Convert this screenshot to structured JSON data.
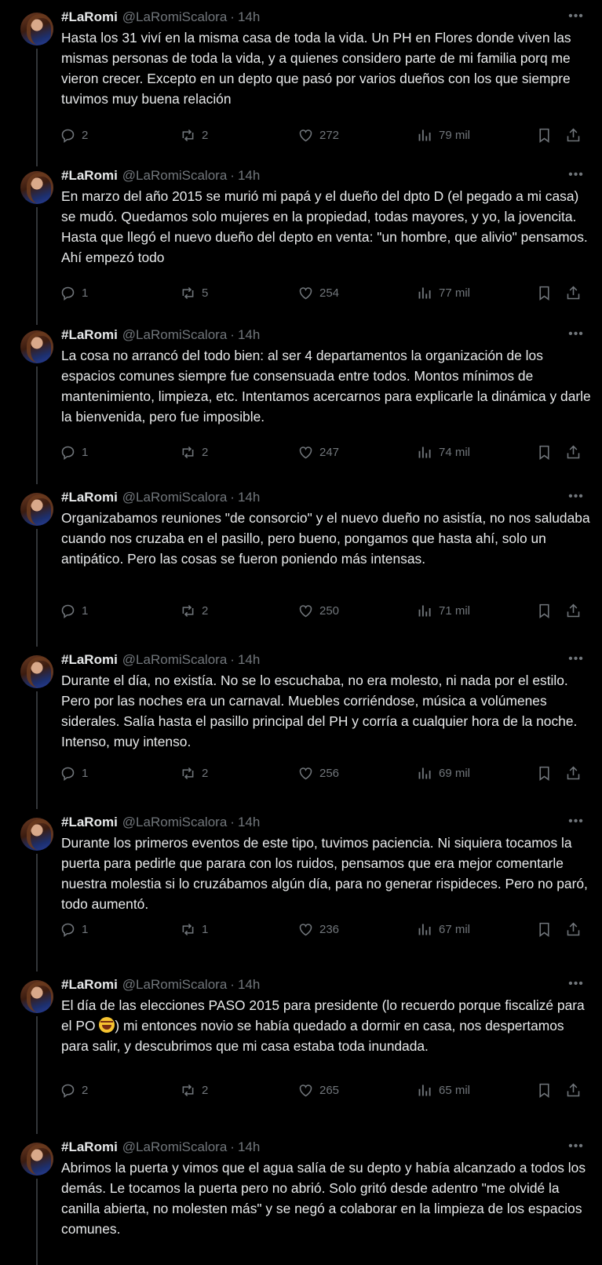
{
  "tweets": [
    {
      "name": "#LaRomi",
      "handle": "@LaRomiScalora",
      "time": "14h",
      "text": "Hasta los 31 viví en la misma casa de toda la vida. Un PH en Flores donde viven las mismas personas de toda la vida, y a quienes considero parte de mi familia porq me vieron crecer. Excepto en un depto que pasó por varios dueños con los que siempre tuvimos muy buena relación",
      "replies": "2",
      "retweets": "2",
      "likes": "272",
      "views": "79 mil"
    },
    {
      "name": "#LaRomi",
      "handle": "@LaRomiScalora",
      "time": "14h",
      "text": "En marzo del año 2015 se murió mi papá y el dueño del dpto D (el pegado a mi casa) se mudó. Quedamos solo mujeres en la propiedad, todas mayores, y yo, la jovencita. Hasta que llegó el nuevo dueño del depto en venta: \"un hombre, que alivio\" pensamos. Ahí empezó todo",
      "replies": "1",
      "retweets": "5",
      "likes": "254",
      "views": "77 mil"
    },
    {
      "name": "#LaRomi",
      "handle": "@LaRomiScalora",
      "time": "14h",
      "text": "La cosa no arrancó del todo bien: al ser 4 departamentos la organización de los espacios comunes siempre fue consensuada entre todos. Montos mínimos de mantenimiento, limpieza, etc. Intentamos acercarnos para explicarle la dinámica y darle la bienvenida, pero fue imposible.",
      "replies": "1",
      "retweets": "2",
      "likes": "247",
      "views": "74 mil"
    },
    {
      "name": "#LaRomi",
      "handle": "@LaRomiScalora",
      "time": "14h",
      "text": "Organizabamos reuniones \"de consorcio\" y el nuevo dueño no asistía, no nos saludaba cuando nos cruzaba en el pasillo, pero bueno, pongamos que hasta ahí, solo un antipático. Pero las cosas se fueron poniendo más intensas.",
      "replies": "1",
      "retweets": "2",
      "likes": "250",
      "views": "71 mil"
    },
    {
      "name": "#LaRomi",
      "handle": "@LaRomiScalora",
      "time": "14h",
      "text": "Durante el día, no existía. No se lo escuchaba, no era molesto, ni nada por el estilo. Pero por las noches era un carnaval. Muebles corriéndose, música a volúmenes siderales. Salía hasta el pasillo principal del PH y corría a cualquier hora de la noche. Intenso, muy intenso.",
      "replies": "1",
      "retweets": "2",
      "likes": "256",
      "views": "69 mil"
    },
    {
      "name": "#LaRomi",
      "handle": "@LaRomiScalora",
      "time": "14h",
      "text": "Durante los primeros eventos de este tipo, tuvimos paciencia. Ni siquiera tocamos la puerta para pedirle que parara con los ruidos, pensamos que era mejor comentarle nuestra molestia si lo cruzábamos algún día, para no generar rispideces. Pero no paró, todo aumentó.",
      "replies": "1",
      "retweets": "1",
      "likes": "236",
      "views": "67 mil"
    },
    {
      "name": "#LaRomi",
      "handle": "@LaRomiScalora",
      "time": "14h",
      "text_before": "El día de las elecciones PASO 2015 para presidente (lo recuerdo porque fiscalizé para el PO ",
      "emoji": "joy-emoji",
      "text_after": ") mi entonces novio se había quedado a dormir en casa, nos despertamos para salir, y descubrimos que mi casa estaba toda inundada.",
      "replies": "2",
      "retweets": "2",
      "likes": "265",
      "views": "65 mil"
    },
    {
      "name": "#LaRomi",
      "handle": "@LaRomiScalora",
      "time": "14h",
      "text": "Abrimos la puerta y vimos que el agua salía de su depto y había alcanzado a todos los demás. Le tocamos la puerta pero no abrió. Solo gritó desde adentro \"me olvidé la canilla abierta, no molesten más\" y se negó a colaborar en la limpieza de los espacios comunes."
    }
  ]
}
